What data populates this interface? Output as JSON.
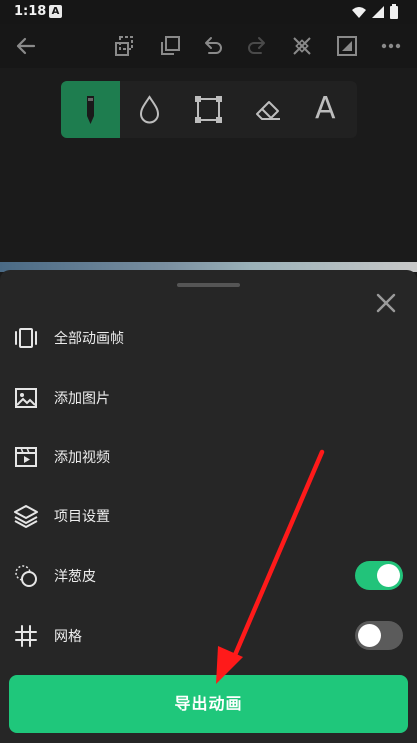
{
  "status_bar": {
    "time": "1:18",
    "notification_letter": "A",
    "icons": [
      "wifi-icon",
      "signal-icon",
      "battery-icon"
    ]
  },
  "toolbar": {
    "buttons": [
      "back-arrow-icon",
      "copy-frame-icon",
      "duplicate-icon",
      "undo-icon",
      "redo-icon",
      "transform-icon",
      "canvas-icon",
      "more-icon"
    ]
  },
  "tools": {
    "items": [
      "pen-tool",
      "fill-tool",
      "shape-tool",
      "eraser-tool",
      "text-tool"
    ],
    "text_tool_glyph": "A",
    "active_index": 0
  },
  "sheet": {
    "menu": [
      {
        "label": "全部动画帧",
        "icon": "frames-icon"
      },
      {
        "label": "添加图片",
        "icon": "image-icon"
      },
      {
        "label": "添加视频",
        "icon": "video-icon"
      },
      {
        "label": "项目设置",
        "icon": "layers-icon"
      },
      {
        "label": "洋葱皮",
        "icon": "onion-skin-icon",
        "toggle": true
      },
      {
        "label": "网格",
        "icon": "grid-icon",
        "toggle": false
      }
    ],
    "export_label": "导出动画"
  },
  "colors": {
    "accent": "#1fc77b",
    "active_tool": "#1e7d4f",
    "annotation_arrow": "#ff1a1a"
  }
}
